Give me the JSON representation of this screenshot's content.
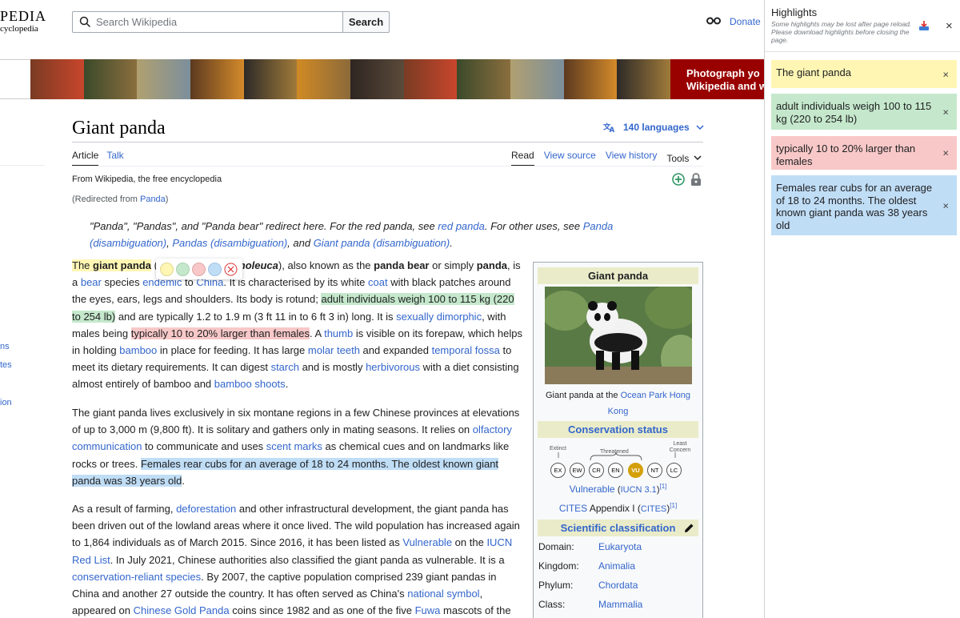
{
  "header": {
    "logo_word": "PEDIA",
    "logo_tagline": "cyclopedia",
    "search_placeholder": "Search Wikipedia",
    "search_button": "Search",
    "donate": "Donate"
  },
  "banner": {
    "text_line1": "Photograph yo",
    "text_line2": "Wikipedia and w"
  },
  "article": {
    "title": "Giant panda",
    "languages": "140 languages",
    "tabs_left": [
      "Article",
      "Talk"
    ],
    "tabs_right": [
      "Read",
      "View source",
      "View history"
    ],
    "tools": "Tools",
    "from": "From Wikipedia, the free encyclopedia",
    "redirected_prefix": "(Redirected from ",
    "redirected_link": "Panda",
    "redirected_suffix": ")",
    "hatnote": {
      "t1": "\"Panda\", \"Pandas\", and \"Panda bear\" redirect here. For the red panda, see ",
      "l1": "red panda",
      "t2": ". For other uses, see ",
      "l2": "Panda (disambiguation)",
      "t3": ", ",
      "l3": "Pandas (disambiguation)",
      "t4": ", and ",
      "l4": "Giant panda (disambiguation)",
      "t5": "."
    },
    "p1": {
      "hl_yellow_a": "The ",
      "hl_yellow_b": "giant panda",
      "s1": " (",
      "sci": "Ailuropoda melanoleuca",
      "s2": "), also known as the ",
      "b1": "panda bear",
      "s3": " or simply ",
      "b2": "panda",
      "s4": ", is a ",
      "l_bear": "bear",
      "s5": " species ",
      "l_endemic": "endemic",
      "s6": " to ",
      "l_china": "China",
      "s7": ". It is characterised by its white ",
      "l_coat": "coat",
      "s8": " with black patches around the eyes, ears, legs and shoulders. Its body is rotund; ",
      "hl_green": "adult individuals weigh 100 to 115 kg (220 to 254 lb)",
      "s9": " and are typically 1.2 to 1.9 m (3 ft 11 in to 6 ft 3 in) long. It is ",
      "l_dimorphic": "sexually dimorphic",
      "s10": ", with males being ",
      "hl_red": "typically 10 to 20% larger than females",
      "s11": ". A ",
      "l_thumb": "thumb",
      "s12": " is visible on its forepaw, which helps in holding ",
      "l_bamboo": "bamboo",
      "s13": " in place for feeding. It has large ",
      "l_molar": "molar teeth",
      "s14": " and expanded ",
      "l_fossa": "temporal fossa",
      "s15": " to meet its dietary requirements. It can digest ",
      "l_starch": "starch",
      "s16": " and is mostly ",
      "l_herb": "herbivorous",
      "s17": " with a diet consisting almost entirely of bamboo and ",
      "l_shoots": "bamboo shoots",
      "s18": "."
    },
    "p2": {
      "s1": "The giant panda lives exclusively in six montane regions in a few Chinese provinces at elevations of up to 3,000 m (9,800 ft). It is solitary and gathers only in mating seasons. It relies on ",
      "l_olf": "olfactory communication",
      "s2": " to communicate and uses ",
      "l_scent": "scent marks",
      "s3": " as chemical cues and on landmarks like rocks or trees. ",
      "hl_blue": "Females rear cubs for an average of 18 to 24 months. The oldest known giant panda was 38 years old",
      "s4": "."
    },
    "p3": {
      "s1": "As a result of farming, ",
      "l_defor": "deforestation",
      "s2": " and other infrastructural development, the giant panda has been driven out of the lowland areas where it once lived. The wild population has increased again to 1,864 individuals as of March 2015. Since 2016, it has been listed as ",
      "l_vuln": "Vulnerable",
      "s3": " on the ",
      "l_iucn": "IUCN Red List",
      "s4": ". In July 2021, Chinese authorities also classified the giant panda as vulnerable. It is a ",
      "l_cons": "conservation-reliant species",
      "s5": ". By 2007, the captive population comprised 239 giant pandas in China and another 27 outside the country. It has often served as China's ",
      "l_nat": "national symbol",
      "s6": ", appeared on ",
      "l_gold": "Chinese Gold Panda",
      "s7": " coins since 1982 and as one of the five ",
      "l_fuwa": "Fuwa",
      "s8": " mascots of the"
    }
  },
  "infobox": {
    "title": "Giant panda",
    "caption_prefix": "Giant panda at the ",
    "caption_link": "Ocean Park Hong Kong",
    "conservation_heading": "Conservation status",
    "scale_labels": {
      "extinct": "Extinct",
      "threatened": "Threatened",
      "least": "Least\nConcern"
    },
    "scale": [
      "EX",
      "EW",
      "CR",
      "EN",
      "VU",
      "NT",
      "LC"
    ],
    "status_link": "Vulnerable",
    "status_src": "IUCN 3.1",
    "ref1": "[1]",
    "cites_link": "CITES",
    "cites_text": " Appendix I (",
    "cites_src": "CITES",
    "cites_close": ")",
    "ref2": "[1]",
    "sci_heading": "Scientific classification",
    "taxonomy": [
      {
        "rank": "Domain:",
        "name": "Eukaryota"
      },
      {
        "rank": "Kingdom:",
        "name": "Animalia"
      },
      {
        "rank": "Phylum:",
        "name": "Chordata"
      },
      {
        "rank": "Class:",
        "name": "Mammalia"
      }
    ]
  },
  "sidebar": {
    "items": [
      "ns",
      "tes",
      "ion"
    ]
  },
  "highlights_panel": {
    "title": "Highlights",
    "note": "Some highlights may be lost after page reload. Please download highlights before closing the page.",
    "items": [
      {
        "text": "The giant panda",
        "color": "#fff6b4"
      },
      {
        "text": "adult individuals weigh 100 to 115 kg (220 to 254 lb)",
        "color": "#c5e8cc"
      },
      {
        "text": "typically 10 to 20% larger than females",
        "color": "#f8c8c8"
      },
      {
        "text": "Females rear cubs for an average of 18 to 24 months. The oldest known giant panda was 38 years old",
        "color": "#c0ddf6"
      }
    ],
    "close_glyph": "×"
  },
  "color_picker": {
    "swatches": [
      "#fff6b4",
      "#c5e8cc",
      "#f8c8c8",
      "#c0ddf6"
    ]
  }
}
